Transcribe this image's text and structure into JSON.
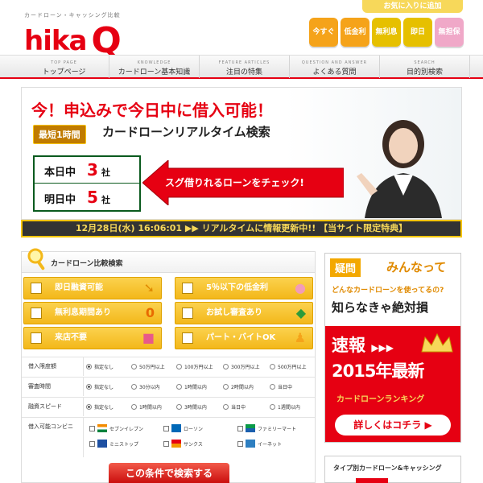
{
  "header": {
    "tagline": "カードローン・キャッシング比較",
    "logo_text": "hika",
    "logo_q": "Q",
    "favorite_label": "お気に入りに追加",
    "quick_links": [
      {
        "label": "今すぐ",
        "color": "#f5a31a"
      },
      {
        "label": "低金利",
        "color": "#f5a31a"
      },
      {
        "label": "無利息",
        "color": "#f3c300"
      },
      {
        "label": "即日",
        "color": "#f3c300"
      },
      {
        "label": "無担保",
        "color": "#f3c300"
      }
    ]
  },
  "nav": [
    {
      "en": "TOP PAGE",
      "jp": "トップページ"
    },
    {
      "en": "KNOWLEDGE",
      "jp": "カードローン基本知識"
    },
    {
      "en": "FEATURE ARTICLES",
      "jp": "注目の特集"
    },
    {
      "en": "QUESTION AND ANSWER",
      "jp": "よくある質問"
    },
    {
      "en": "SEARCH",
      "jp": "目的別検索"
    }
  ],
  "hero": {
    "headline": "今！申込みで今日中に借入可能！",
    "badge": "最短1時間",
    "subtitle": "カードローンリアルタイム検索",
    "today_label": "本日中",
    "today_count": "3",
    "tomorrow_label": "明日中",
    "tomorrow_count": "5",
    "count_unit": "社",
    "arrow_text": "スグ借りれるローンをチェック!"
  },
  "ticker": "12月28日(水) 16:06:01 ▶▶ リアルタイムに情報更新中!! 【当サイト限定特典】",
  "search": {
    "title": "カードローン比較検索",
    "checks": [
      {
        "label": "即日融資可能",
        "icon": "arrow-icon"
      },
      {
        "label": "5％以下の低金利",
        "icon": "piggy-bank-icon"
      },
      {
        "label": "無利息期間あり",
        "icon": "zero-icon"
      },
      {
        "label": "お試し審査あり",
        "icon": "leaf-mark-icon"
      },
      {
        "label": "来店不要",
        "icon": "shop-icon"
      },
      {
        "label": "パート・バイトOK",
        "icon": "person-icon"
      }
    ],
    "filters": [
      {
        "label": "借入限度額",
        "options": [
          "指定なし",
          "50万円以上",
          "100万円以上",
          "300万円以上",
          "500万円以上"
        ]
      },
      {
        "label": "審査時間",
        "options": [
          "指定なし",
          "30分以内",
          "1時間以内",
          "2時間以内",
          "当日中"
        ]
      },
      {
        "label": "融資スピード",
        "options": [
          "指定なし",
          "1時間以内",
          "3時間以内",
          "当日中",
          "1週間以内"
        ]
      }
    ],
    "convenience_label": "借入可能コンビニ",
    "convenience": [
      "セブンイレブン",
      "ローソン",
      "ファミリーマート",
      "ミニストップ",
      "サンクス",
      "イーネット"
    ],
    "button": "この条件で検索する"
  },
  "ad": {
    "question_tag": "疑問",
    "minnatte": "みんなって",
    "question": "どんなカードローンを使ってるの?",
    "must_know": "知らなきゃ絶対損",
    "flash": "速報",
    "arrows": "▶▶▶",
    "year": "2015年最新",
    "ranking": "カードローンランキング",
    "button": "詳しくはコチラ ▶"
  },
  "side": {
    "title": "タイプ別カードローン&キャッシング"
  }
}
